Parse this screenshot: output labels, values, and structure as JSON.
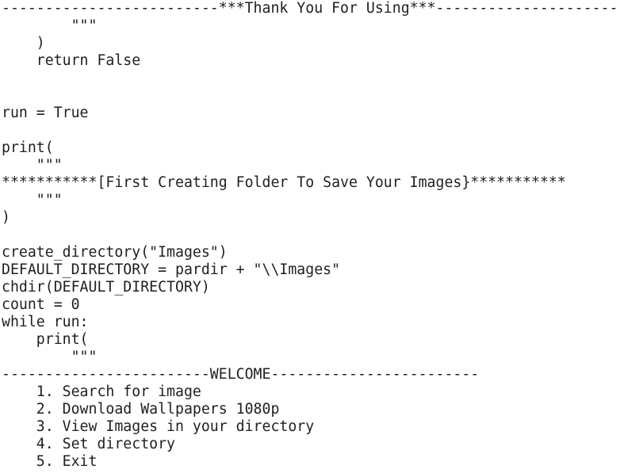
{
  "code_lines": [
    "-------------------------***Thank You For Using***---------------------",
    "        \"\"\"",
    "    )",
    "    return False",
    "",
    "",
    "run = True",
    "",
    "print(",
    "    \"\"\"",
    "***********[First Creating Folder To Save Your Images}***********",
    "    \"\"\"",
    ")",
    "",
    "create_directory(\"Images\")",
    "DEFAULT_DIRECTORY = pardir + \"\\\\Images\"",
    "chdir(DEFAULT_DIRECTORY)",
    "count = 0",
    "while run:",
    "    print(",
    "        \"\"\"",
    "------------------------WELCOME------------------------",
    "    1. Search for image",
    "    2. Download Wallpapers 1080p",
    "    3. View Images in your directory",
    "    4. Set directory",
    "    5. Exit"
  ]
}
